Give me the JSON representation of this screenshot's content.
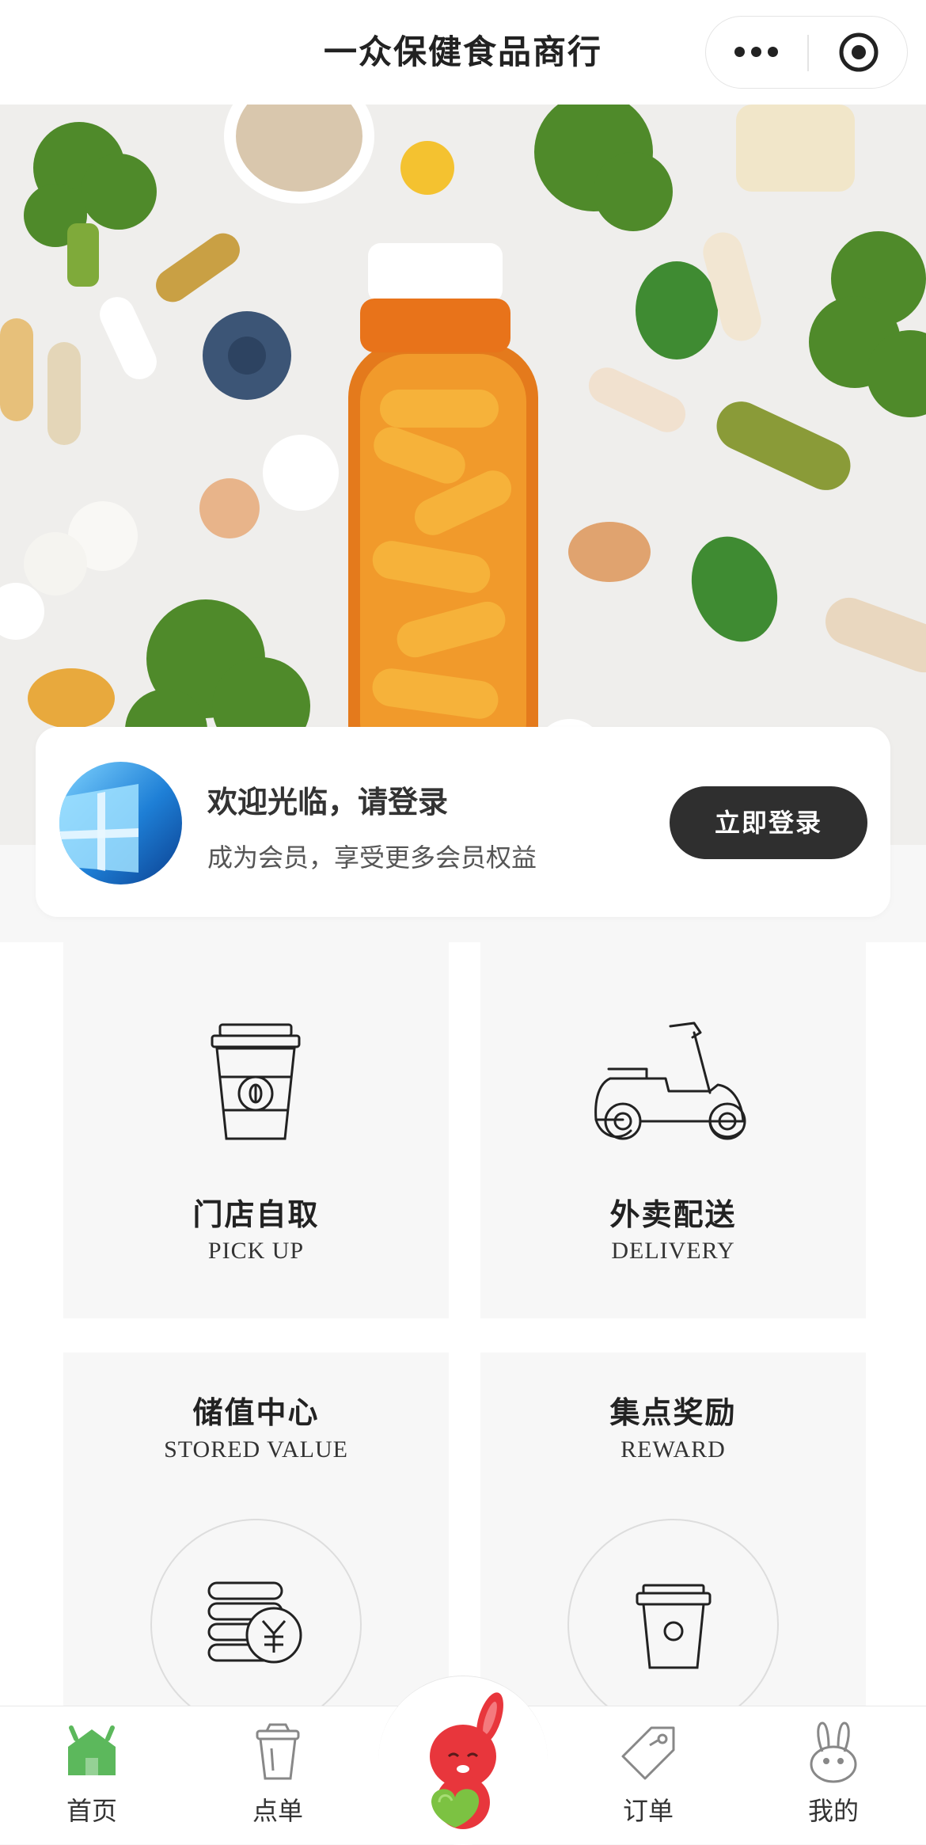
{
  "header": {
    "title": "一众保健食品商行",
    "more_icon": "more-dots-icon",
    "target_icon": "target-circle-icon"
  },
  "banner": {
    "image": "supplement-bottle-vegetables-photo"
  },
  "login_card": {
    "welcome": "欢迎光临，请登录",
    "subtitle": "成为会员，享受更多会员权益",
    "button_label": "立即登录"
  },
  "tiles": {
    "pickup": {
      "title": "门店自取",
      "subtitle": "PICK UP",
      "icon": "coffee-cup-icon"
    },
    "delivery": {
      "title": "外卖配送",
      "subtitle": "DELIVERY",
      "icon": "scooter-icon"
    },
    "stored_value": {
      "title": "储值中心",
      "subtitle": "STORED VALUE",
      "icon": "coins-yuan-icon"
    },
    "reward": {
      "title": "集点奖励",
      "subtitle": "REWARD",
      "icon": "cup-icon"
    }
  },
  "tabbar": {
    "items": [
      {
        "label": "首页",
        "icon": "home-icon",
        "active": true
      },
      {
        "label": "点单",
        "icon": "cup-icon"
      },
      {
        "label": "",
        "icon": "mascot-rabbit-icon"
      },
      {
        "label": "订单",
        "icon": "tag-icon"
      },
      {
        "label": "我的",
        "icon": "rabbit-icon"
      }
    ]
  },
  "colors": {
    "active_tab": "#5cb85c",
    "login_button": "#2f2f2f",
    "tile_bg": "#f7f7f7"
  }
}
